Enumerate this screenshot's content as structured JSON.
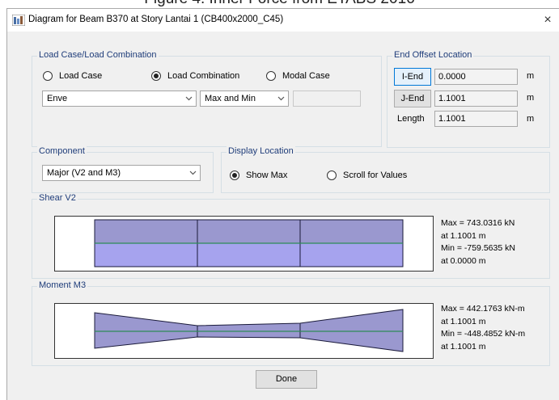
{
  "caption": "Figure 4. Inner Force from ETABS 2016",
  "window": {
    "title": "Diagram for Beam B370 at Story Lantai 1 (CB400x2000_C45)",
    "close_glyph": "×"
  },
  "load_case_group": {
    "label": "Load Case/Load Combination",
    "options": [
      {
        "label": "Load Case",
        "selected": false
      },
      {
        "label": "Load Combination",
        "selected": true
      },
      {
        "label": "Modal Case",
        "selected": false
      }
    ],
    "combo_value": "Enve",
    "type_value": "Max and Min",
    "extra_value": ""
  },
  "end_offset_group": {
    "label": "End Offset Location",
    "i_end_label": "I-End",
    "i_end_value": "0.0000",
    "j_end_label": "J-End",
    "j_end_value": "1.1001",
    "length_label": "Length",
    "length_value": "1.1001",
    "unit": "m"
  },
  "component_group": {
    "label": "Component",
    "value": "Major (V2 and M3)"
  },
  "display_location_group": {
    "label": "Display Location",
    "options": [
      {
        "label": "Show Max",
        "selected": true
      },
      {
        "label": "Scroll for Values",
        "selected": false
      }
    ]
  },
  "shear_group": {
    "label": "Shear V2",
    "info": [
      "Max = 743.0316 kN",
      "at 1.1001 m",
      "Min = -759.5635 kN",
      "at 0.0000 m"
    ]
  },
  "moment_group": {
    "label": "Moment M3",
    "info": [
      "Max = 442.1763 kN-m",
      "at 1.1001 m",
      "Min = -448.4852 kN-m",
      "at 1.1001 m"
    ]
  },
  "done_label": "Done",
  "colors": {
    "fill_upper": "#9a98cf",
    "fill_lower": "#a6a3ee",
    "axis": "#2e8b57",
    "outline": "#1a1a3a"
  },
  "icons": {
    "app": "etabs-app-icon",
    "close": "close-icon",
    "dropdown": "chevron-down-icon"
  }
}
